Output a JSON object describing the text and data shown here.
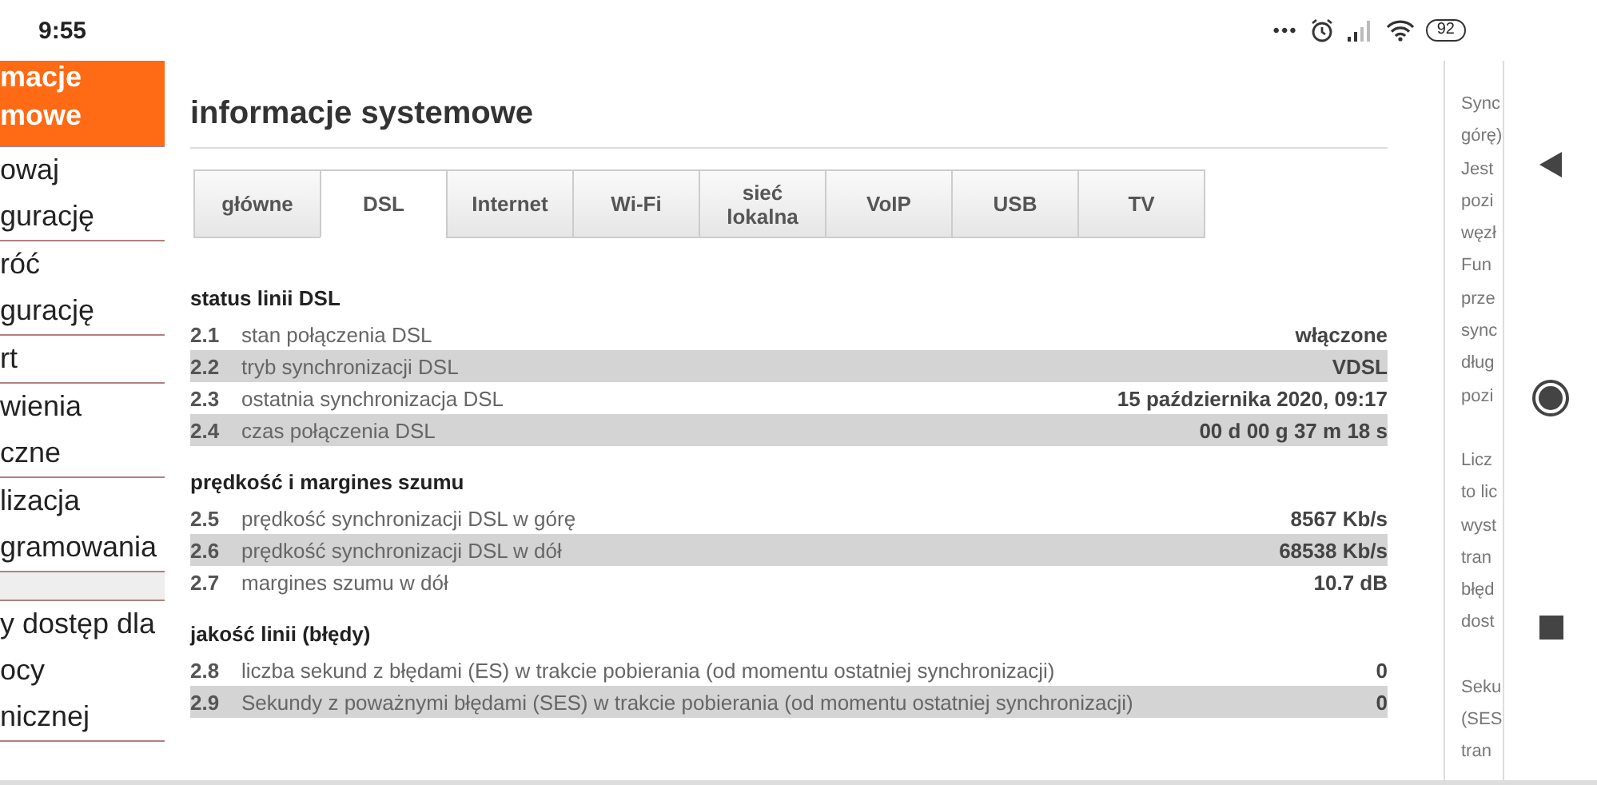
{
  "status_bar": {
    "time": "9:55",
    "more": "•••",
    "battery": "92"
  },
  "sidebar": {
    "items": [
      {
        "lines": [
          "macje",
          "mowe"
        ],
        "selected": true
      },
      {
        "lines": [
          "owaj",
          "gurację"
        ],
        "selected": false
      },
      {
        "lines": [
          "róć",
          "gurację"
        ],
        "selected": false
      },
      {
        "lines": [
          "rt"
        ],
        "selected": false
      },
      {
        "lines": [
          "wienia",
          "czne"
        ],
        "selected": false
      },
      {
        "lines": [
          "lizacja",
          "gramowania"
        ],
        "selected": false
      },
      {
        "selected": false
      },
      {
        "lines": [
          "y dostęp dla",
          "ocy",
          "nicznej"
        ],
        "selected": false
      }
    ]
  },
  "page": {
    "title": "informacje systemowe"
  },
  "tabs": [
    {
      "label": "główne",
      "selected": false
    },
    {
      "label": "DSL",
      "selected": true
    },
    {
      "label": "Internet",
      "selected": false
    },
    {
      "label": "Wi-Fi",
      "selected": false
    },
    {
      "label": "sieć lokalna",
      "selected": false
    },
    {
      "label": "VoIP",
      "selected": false
    },
    {
      "label": "USB",
      "selected": false
    },
    {
      "label": "TV",
      "selected": false
    }
  ],
  "sections": [
    {
      "title": "status linii DSL",
      "rows": [
        {
          "number": "2.1",
          "label": "stan połączenia DSL",
          "value": "włączone"
        },
        {
          "number": "2.2",
          "label": "tryb synchronizacji DSL",
          "value": "VDSL"
        },
        {
          "number": "2.3",
          "label": "ostatnia synchronizacja DSL",
          "value": "15 października 2020, 09:17"
        },
        {
          "number": "2.4",
          "label": "czas połączenia DSL",
          "value": "00 d 00 g 37 m 18 s"
        }
      ]
    },
    {
      "title": "prędkość i margines szumu",
      "rows": [
        {
          "number": "2.5",
          "label": "prędkość synchronizacji DSL w górę",
          "value": "8567 Kb/s"
        },
        {
          "number": "2.6",
          "label": "prędkość synchronizacji DSL w dół",
          "value": "68538 Kb/s"
        },
        {
          "number": "2.7",
          "label": "margines szumu w dół",
          "value": "10.7 dB"
        }
      ]
    },
    {
      "title": "jakość linii (błędy)",
      "rows": [
        {
          "number": "2.8",
          "label": "liczba sekund z błędami (ES) w trakcie pobierania (od momentu ostatniej synchronizacji)",
          "value": "0"
        },
        {
          "number": "2.9",
          "label": "Sekundy z poważnymi błędami (SES) w trakcie pobierania (od momentu ostatniej synchronizacji)",
          "value": "0"
        }
      ]
    }
  ],
  "help_panel": {
    "paragraphs": [
      [
        "Sync",
        "górę)",
        "Jest",
        "pozi",
        "węzł",
        "Fun",
        "prze",
        "sync",
        "dług",
        "pozi"
      ],
      [
        "Licz",
        "to lic",
        "wyst",
        "tran",
        "błęd",
        "dost"
      ],
      [
        "Seku",
        "(SES",
        "tran"
      ]
    ]
  }
}
